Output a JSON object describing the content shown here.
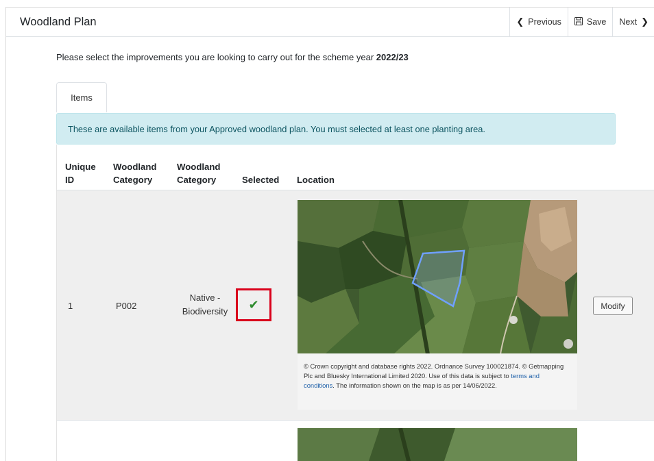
{
  "header": {
    "title": "Woodland Plan",
    "previous_label": "Previous",
    "save_label": "Save",
    "next_label": "Next"
  },
  "intro": {
    "text": "Please select the improvements you are looking to carry out for the scheme year",
    "year": "2022/23"
  },
  "tabs": [
    {
      "label": "Items"
    }
  ],
  "alert": {
    "text": "These are available items from your Approved woodland plan. You must selected at least one planting area."
  },
  "table": {
    "columns": [
      {
        "line1": "Unique",
        "line2": "ID"
      },
      {
        "line1": "Woodland",
        "line2": "Category"
      },
      {
        "line1": "Woodland",
        "line2": "Category"
      },
      {
        "line1": "",
        "line2": "Selected"
      },
      {
        "line1": "",
        "line2": "Location"
      }
    ],
    "rows": [
      {
        "unique_id": "1",
        "code": "P002",
        "category_line1": "Native -",
        "category_line2": "Biodiversity",
        "selected": true,
        "modify_label": "Modify",
        "attribution": {
          "text_before": "© Crown copyright and database rights 2022. Ordnance Survey 100021874. © Getmapping Plc and Bluesky International Limited 2020. Use of this data is subject to",
          "link_text": "terms and conditions",
          "text_after": ". The information shown on the map is as per 14/06/2022."
        }
      }
    ]
  },
  "colors": {
    "alert_bg": "#d1ecf1",
    "alert_text": "#0c5460",
    "selected_tick": "#2e8b2e",
    "highlight_border": "#d9001b",
    "polygon_stroke": "#6fa0ff",
    "link": "#1d5fa8"
  },
  "icons": {
    "previous": "chevron-left-icon",
    "save": "save-icon",
    "next": "chevron-right-icon",
    "selected": "check-icon"
  }
}
